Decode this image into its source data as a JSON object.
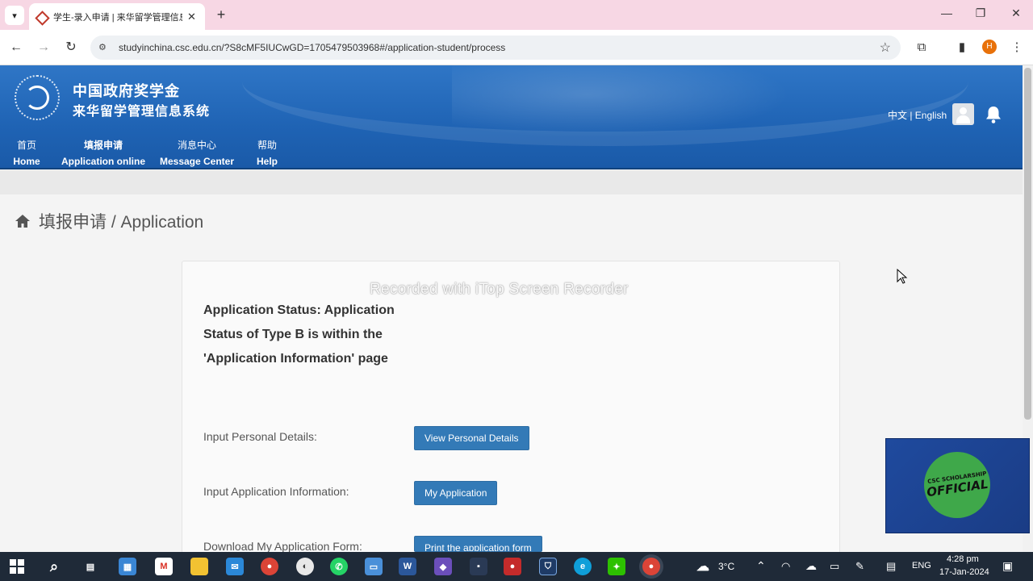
{
  "browser": {
    "tab_title": "学生-录入申请 | 来华留学管理信息系统",
    "url": "studyinchina.csc.edu.cn/?S8cMF5IUCwGD=1705479503968#/application-student/process",
    "profile_initial": "H"
  },
  "header": {
    "brand_line1": "中国政府奖学金",
    "brand_line2": "来华留学管理信息系统",
    "lang_switch": "中文 | English",
    "nav": [
      {
        "cn": "首页",
        "en": "Home"
      },
      {
        "cn": "填报申请",
        "en": "Application online"
      },
      {
        "cn": "消息中心",
        "en": "Message Center"
      },
      {
        "cn": "帮助",
        "en": "Help"
      }
    ]
  },
  "page": {
    "breadcrumb": "填报申请 / Application",
    "watermark": "Recorded with iTop Screen Recorder",
    "status_heading": "Application Status: Application Status of Type B is within the 'Application Information' page",
    "rows": [
      {
        "label": "Input Personal Details:",
        "button": "View Personal Details"
      },
      {
        "label": "Input Application Information:",
        "button": "My Application"
      },
      {
        "label": "Download My Application Form:",
        "button": "Print the application form"
      }
    ]
  },
  "overlay": {
    "badge_line1": "CSC SCHOLARSHIP",
    "badge_line2": "OFFICIAL"
  },
  "taskbar": {
    "temperature": "3°C",
    "language": "ENG",
    "time": "4:28 pm",
    "date": "17-Jan-2024"
  },
  "colors": {
    "header_blue": "#2368b8",
    "button_blue": "#337ab7",
    "tab_bar_pink": "#f7d7e4",
    "badge_green": "#3fa84a"
  }
}
